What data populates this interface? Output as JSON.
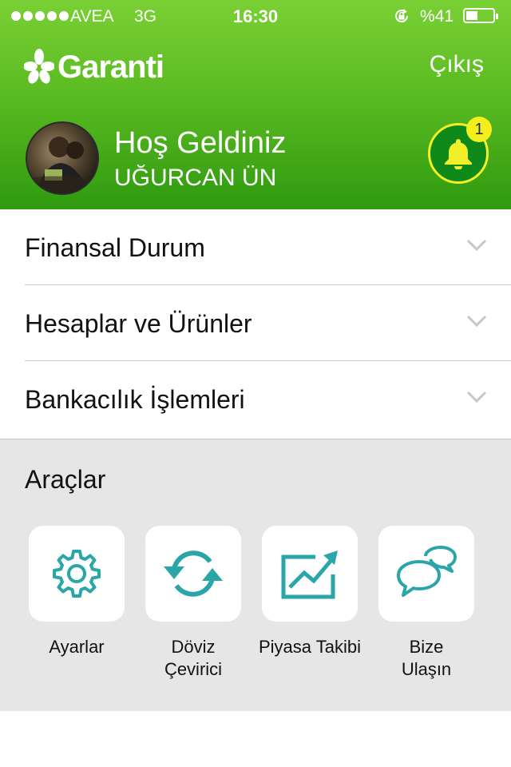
{
  "status_bar": {
    "carrier": "AVEA",
    "network": "3G",
    "time": "16:30",
    "battery_text": "%41",
    "battery_level": 0.41
  },
  "header": {
    "brand": "Garanti",
    "logout_label": "Çıkış",
    "welcome": "Hoş Geldiniz",
    "username": "UĞURCAN ÜN",
    "notification_count": "1",
    "colors": {
      "brand_green": "#5bbb22",
      "dark_green": "#2f9a0f",
      "badge_yellow": "#f4ee1d"
    }
  },
  "menu": {
    "items": [
      {
        "label": "Finansal Durum"
      },
      {
        "label": "Hesaplar ve Ürünler"
      },
      {
        "label": "Bankacılık İşlemleri"
      }
    ]
  },
  "tools": {
    "title": "Araçlar",
    "accent": "#2aa5a8",
    "items": [
      {
        "label": "Ayarlar",
        "icon": "gear-icon"
      },
      {
        "label": "Döviz\nÇevirici",
        "icon": "refresh-icon"
      },
      {
        "label": "Piyasa Takibi",
        "icon": "trend-chart-icon"
      },
      {
        "label": "Bize\nUlaşın",
        "icon": "chat-bubbles-icon"
      }
    ]
  }
}
